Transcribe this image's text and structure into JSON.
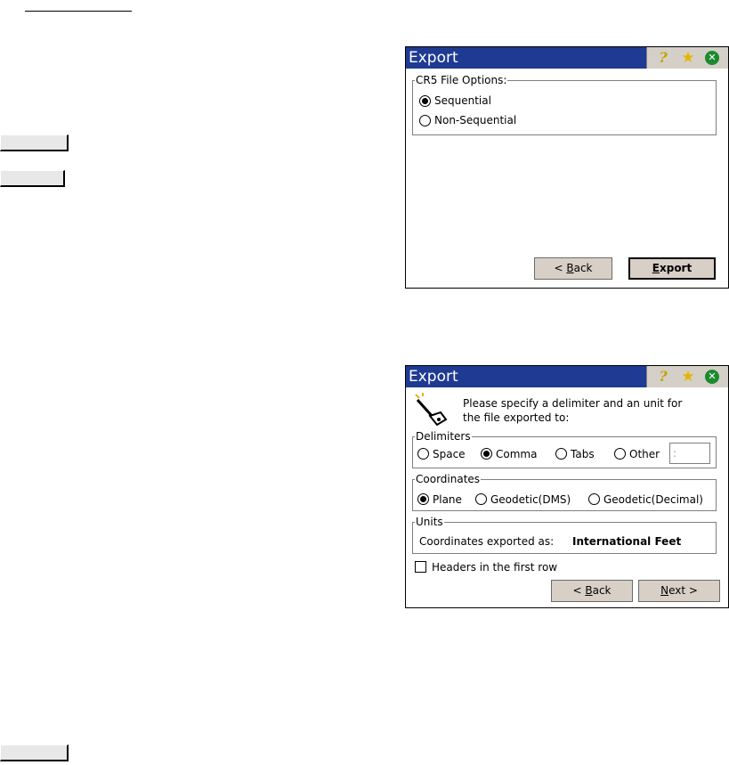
{
  "dialog1": {
    "title": "Export",
    "group_label": "CR5 File Options:",
    "options": [
      "Sequential",
      "Non-Sequential"
    ],
    "selected_option": "Sequential",
    "back_button": {
      "prefix": "< ",
      "accel": "B",
      "rest": "ack"
    },
    "export_button": {
      "accel": "E",
      "rest": "xport"
    }
  },
  "dialog2": {
    "title": "Export",
    "instruction_line1": "Please specify a delimiter and an unit for",
    "instruction_line2": "the file exported to:",
    "delimiters": {
      "label": "Delimiters",
      "options": [
        "Space",
        "Comma",
        "Tabs",
        "Other"
      ],
      "selected": "Comma",
      "other_value": ":"
    },
    "coordinates": {
      "label": "Coordinates",
      "options": [
        "Plane",
        "Geodetic(DMS)",
        "Geodetic(Decimal)"
      ],
      "selected": "Plane"
    },
    "units": {
      "label": "Units",
      "caption": "Coordinates exported as:",
      "value": "International Feet"
    },
    "headers_checkbox": {
      "label": "Headers in the first row",
      "checked": false
    },
    "back_button": {
      "prefix": "< ",
      "accel": "B",
      "rest": "ack"
    },
    "next_button": {
      "accel": "N",
      "rest": "ext >"
    }
  },
  "titlebar_icons": [
    "help-icon",
    "star-icon",
    "close-icon"
  ],
  "colors": {
    "titlebar": "#1f3a93",
    "button_face": "#d8cfc6",
    "icon_panel": "#d4d0c8"
  }
}
